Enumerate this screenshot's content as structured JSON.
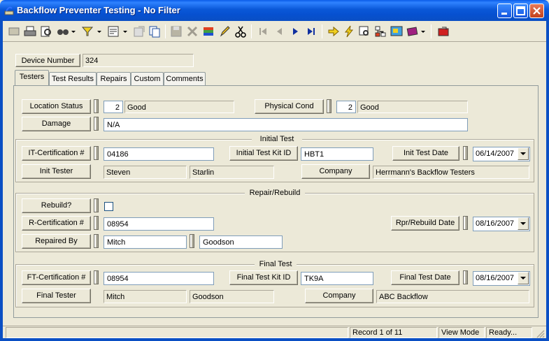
{
  "window": {
    "title": "Backflow Preventer Testing - No Filter"
  },
  "device": {
    "label": "Device Number",
    "value": "324"
  },
  "tabs": [
    "Testers",
    "Test Results",
    "Repairs",
    "Custom",
    "Comments"
  ],
  "top": {
    "location_status": {
      "label": "Location Status",
      "code": "2",
      "value": "Good"
    },
    "physical_cond": {
      "label": "Physical Cond",
      "code": "2",
      "value": "Good"
    },
    "damage": {
      "label": "Damage",
      "value": "N/A"
    }
  },
  "initial_test": {
    "group_label": "Initial Test",
    "cert_label": "IT-Certification #",
    "cert_value": "04186",
    "kit_label": "Initial Test Kit ID",
    "kit_value": "HBT1",
    "date_label": "Init Test Date",
    "date_value": "06/14/2007",
    "tester_label": "Init Tester",
    "tester_first": "Steven",
    "tester_last": "Starlin",
    "company_label": "Company",
    "company_value": "Herrmann's Backflow Testers"
  },
  "repair": {
    "group_label": "Repair/Rebuild",
    "rebuild_label": "Rebuild?",
    "cert_label": "R-Certification #",
    "cert_value": "08954",
    "date_label": "Rpr/Rebuild Date",
    "date_value": "08/16/2007",
    "by_label": "Repaired By",
    "by_first": "Mitch",
    "by_last": "Goodson"
  },
  "final_test": {
    "group_label": "Final Test",
    "cert_label": "FT-Certification #",
    "cert_value": "08954",
    "kit_label": "Final Test Kit ID",
    "kit_value": "TK9A",
    "date_label": "Final Test Date",
    "date_value": "08/16/2007",
    "tester_label": "Final Tester",
    "tester_first": "Mitch",
    "tester_last": "Goodson",
    "company_label": "Company",
    "company_value": "ABC Backflow"
  },
  "status": {
    "record": "Record 1 of 11",
    "mode": "View Mode",
    "state": "Ready..."
  },
  "colors": {
    "title_bar": "#0a58d8",
    "face": "#ece9d8"
  }
}
